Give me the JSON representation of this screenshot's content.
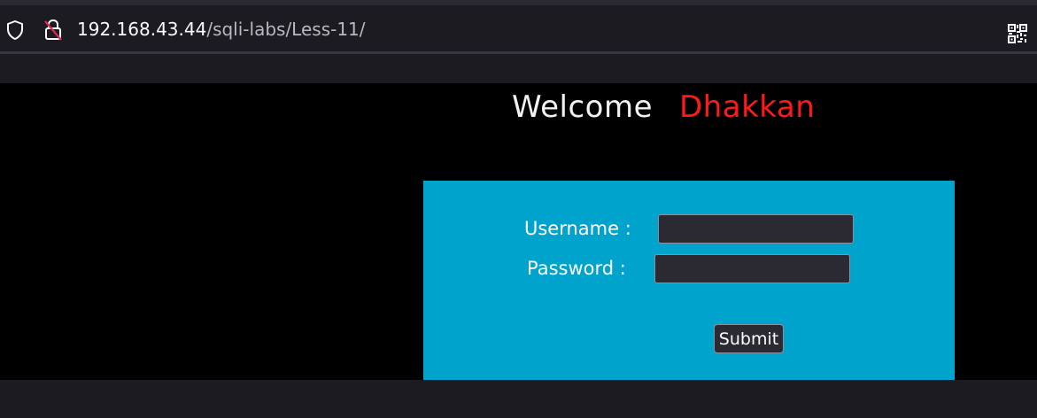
{
  "browser": {
    "url_host": "192.168.43.44",
    "url_path": "/sqli-labs/Less-11/",
    "icons": [
      "shield-icon",
      "lock-insecure-icon",
      "qr-code-icon"
    ]
  },
  "page": {
    "welcome_text": "Welcome",
    "welcome_name": "Dhakkan",
    "colors": {
      "background": "#000000",
      "welcome": "#f2f2f2",
      "name": "#ff1a1a",
      "login_box": "#00a3cc"
    }
  },
  "login_form": {
    "username_label": "Username :",
    "password_label": "Password :",
    "username_value": "",
    "password_value": "",
    "submit_label": "Submit"
  }
}
